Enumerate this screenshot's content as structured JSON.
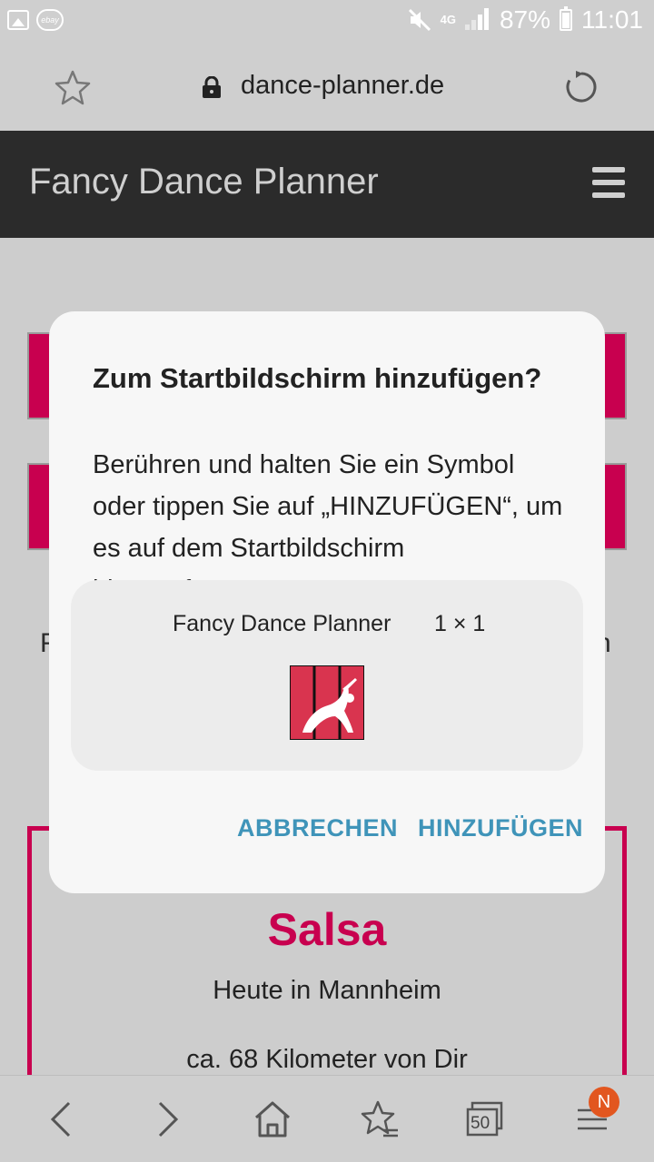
{
  "status_bar": {
    "network": "4G",
    "battery": "87%",
    "time": "11:01",
    "icons": [
      "image-icon",
      "ebay-icon",
      "mute-icon",
      "signal-icon",
      "battery-icon"
    ]
  },
  "browser": {
    "url": "dance-planner.de"
  },
  "site": {
    "title": "Fancy Dance Planner"
  },
  "page": {
    "left_letter": "F",
    "right_letter": "n",
    "card": {
      "title": "Salsa",
      "line1": "Heute in Mannheim",
      "line2": "ca. 68 Kilometer von Dir"
    },
    "accent_color": "#c8004f"
  },
  "dialog": {
    "title": "Zum Startbildschirm hinzufügen?",
    "body": "Berühren und halten Sie ein Symbol oder tippen Sie auf „HINZUFÜGEN“, um es auf dem Startbildschirm hinzuzufügen.",
    "widget": {
      "name": "Fancy Dance Planner",
      "size": "1 × 1"
    },
    "cancel_label": "ABBRECHEN",
    "add_label": "HINZUFÜGEN",
    "button_color": "#3f94b9"
  },
  "bottom_nav": {
    "tabs_count": "50",
    "badge": "N"
  }
}
